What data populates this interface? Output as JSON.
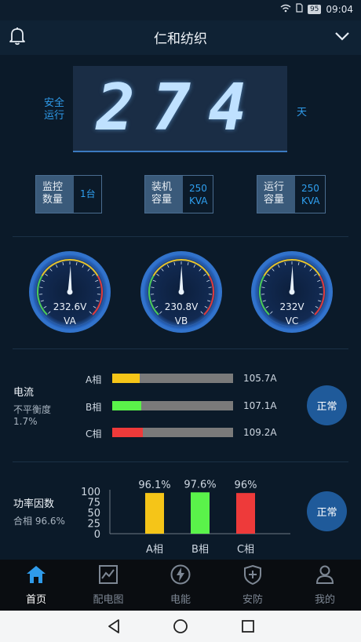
{
  "status_bar": {
    "battery": "95",
    "time": "09:04"
  },
  "header": {
    "title": "仁和纺织"
  },
  "safe_run": {
    "label_line1": "安全",
    "label_line2": "运行",
    "days": "274",
    "unit": "天"
  },
  "info_boxes": [
    {
      "key_line1": "监控",
      "key_line2": "数量",
      "value_line1": "1台",
      "value_line2": ""
    },
    {
      "key_line1": "装机",
      "key_line2": "容量",
      "value_line1": "250",
      "value_line2": "KVA"
    },
    {
      "key_line1": "运行",
      "key_line2": "容量",
      "value_line1": "250",
      "value_line2": "KVA"
    }
  ],
  "gauges": [
    {
      "value": "232.6V",
      "name": "VA",
      "level": 232.6
    },
    {
      "value": "230.8V",
      "name": "VB",
      "level": 230.8
    },
    {
      "value": "232V",
      "name": "VC",
      "level": 232
    }
  ],
  "current": {
    "title": "电流",
    "sub_line1": "不平衡度",
    "sub_line2": "1.7%",
    "status": "正常",
    "phases": [
      {
        "label": "A相",
        "value": "105.7A",
        "fill": 0.23,
        "color": "#f5c518"
      },
      {
        "label": "B相",
        "value": "107.1A",
        "fill": 0.24,
        "color": "#5af24a"
      },
      {
        "label": "C相",
        "value": "109.2A",
        "fill": 0.25,
        "color": "#ee3a3a"
      }
    ]
  },
  "power_factor": {
    "title": "功率因数",
    "sub": "合相 96.6%",
    "status": "正常"
  },
  "chart_data": {
    "type": "bar",
    "categories": [
      "A相",
      "B相",
      "C相"
    ],
    "values": [
      96.1,
      97.6,
      96
    ],
    "data_labels": [
      "96.1%",
      "97.6%",
      "96%"
    ],
    "colors": [
      "#f5c518",
      "#5af24a",
      "#ee3a3a"
    ],
    "yticks": [
      "100",
      "75",
      "50",
      "25",
      "0"
    ],
    "ylim": [
      0,
      100
    ],
    "title": "",
    "xlabel": "",
    "ylabel": ""
  },
  "tabs": [
    {
      "label": "首页",
      "icon": "home-icon",
      "active": true
    },
    {
      "label": "配电图",
      "icon": "chart-icon",
      "active": false
    },
    {
      "label": "电能",
      "icon": "lightning-icon",
      "active": false
    },
    {
      "label": "安防",
      "icon": "shield-icon",
      "active": false
    },
    {
      "label": "我的",
      "icon": "user-icon",
      "active": false
    }
  ]
}
